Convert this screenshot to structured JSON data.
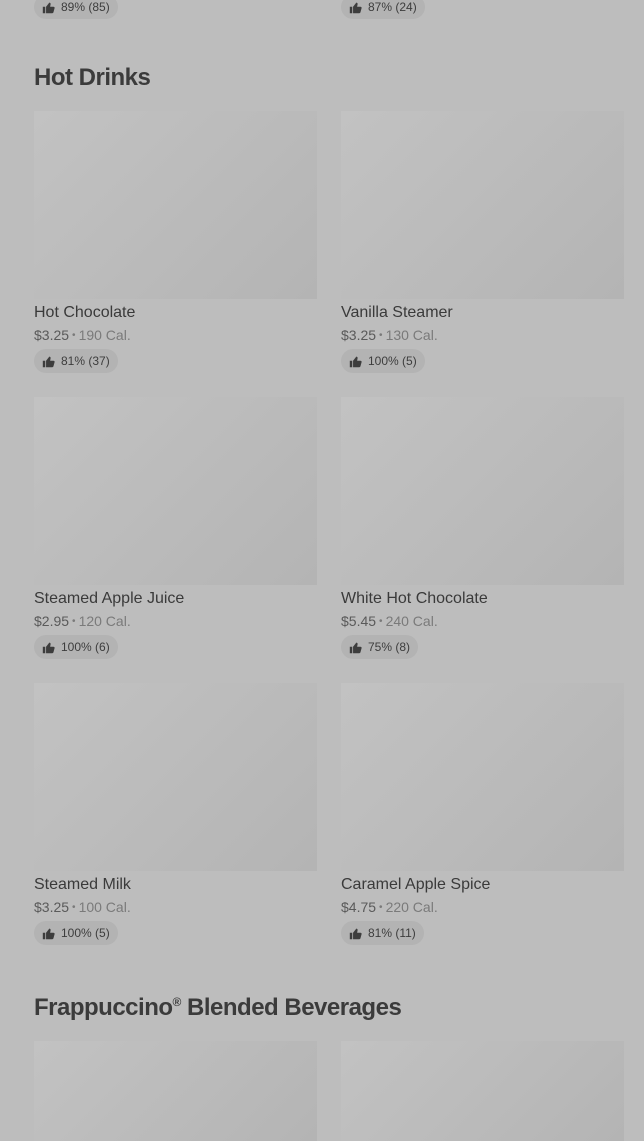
{
  "top_row": [
    {
      "rating": "89% (85)"
    },
    {
      "rating": "87% (24)"
    }
  ],
  "sections": [
    {
      "title": "Hot Drinks",
      "items": [
        {
          "name": "Hot Chocolate",
          "price": "$3.25",
          "calories": "190 Cal.",
          "rating": "81% (37)"
        },
        {
          "name": "Vanilla Steamer",
          "price": "$3.25",
          "calories": "130 Cal.",
          "rating": "100% (5)"
        },
        {
          "name": "Steamed Apple Juice",
          "price": "$2.95",
          "calories": "120 Cal.",
          "rating": "100% (6)"
        },
        {
          "name": "White Hot Chocolate",
          "price": "$5.45",
          "calories": "240 Cal.",
          "rating": "75% (8)"
        },
        {
          "name": "Steamed Milk",
          "price": "$3.25",
          "calories": "100 Cal.",
          "rating": "100% (5)"
        },
        {
          "name": "Caramel Apple Spice",
          "price": "$4.75",
          "calories": "220 Cal.",
          "rating": "81% (11)"
        }
      ]
    },
    {
      "title": "Frappuccino",
      "title_mark": "®",
      "title_rest": " Blended Beverages"
    }
  ],
  "icons": {
    "rating": "thumbs-up-icon"
  },
  "colors": {
    "background": "#bdbdbd",
    "pill": "#b3b3b3",
    "text": "#3d3d3d"
  },
  "separator": "•"
}
